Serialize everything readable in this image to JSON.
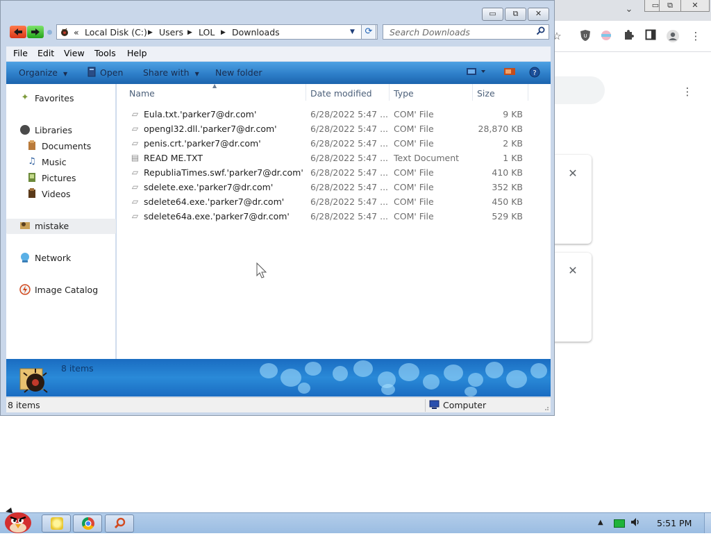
{
  "explorer": {
    "window_controls": {
      "minimize": "▭",
      "maximize": "⧉",
      "close": "✕"
    },
    "breadcrumb": [
      "Local Disk (C:)",
      "Users",
      "LOL",
      "Downloads"
    ],
    "search_placeholder": "Search Downloads",
    "menu": [
      "File",
      "Edit",
      "View",
      "Tools",
      "Help"
    ],
    "commands": {
      "organize": "Organize",
      "open": "Open",
      "share_with": "Share with",
      "new_folder": "New folder"
    },
    "nav": {
      "favorites": "Favorites",
      "libraries": "Libraries",
      "library_items": [
        "Documents",
        "Music",
        "Pictures",
        "Videos"
      ],
      "user": "mistake",
      "network": "Network",
      "image_catalog": "Image Catalog"
    },
    "columns": {
      "name": "Name",
      "date": "Date modified",
      "type": "Type",
      "size": "Size"
    },
    "files": [
      {
        "name": "Eula.txt.'parker7@dr.com'",
        "date": "6/28/2022 5:47 ...",
        "type": "COM' File",
        "size": "9 KB"
      },
      {
        "name": "opengl32.dll.'parker7@dr.com'",
        "date": "6/28/2022 5:47 ...",
        "type": "COM' File",
        "size": "28,870 KB"
      },
      {
        "name": "penis.crt.'parker7@dr.com'",
        "date": "6/28/2022 5:47 ...",
        "type": "COM' File",
        "size": "2 KB"
      },
      {
        "name": "READ ME.TXT",
        "date": "6/28/2022 5:47 ...",
        "type": "Text Document",
        "size": "1 KB"
      },
      {
        "name": "RepubliaTimes.swf.'parker7@dr.com'",
        "date": "6/28/2022 5:47 ...",
        "type": "COM' File",
        "size": "410 KB"
      },
      {
        "name": "sdelete.exe.'parker7@dr.com'",
        "date": "6/28/2022 5:47 ...",
        "type": "COM' File",
        "size": "352 KB"
      },
      {
        "name": "sdelete64.exe.'parker7@dr.com'",
        "date": "6/28/2022 5:47 ...",
        "type": "COM' File",
        "size": "450 KB"
      },
      {
        "name": "sdelete64a.exe.'parker7@dr.com'",
        "date": "6/28/2022 5:47 ...",
        "type": "COM' File",
        "size": "529 KB"
      }
    ],
    "details_count": "8 items",
    "status_count": "8 items",
    "status_location": "Computer"
  },
  "chrome": {
    "window_controls": {
      "chevron": "⌄",
      "minimize": "▭",
      "restore": "⧉",
      "close": "✕"
    },
    "extension_icons": [
      "star-icon",
      "ublock-icon",
      "translate-icon",
      "puzzle-icon",
      "sidepanel-icon",
      "profile-icon",
      "kebab-menu-icon"
    ],
    "card_close": "✕"
  },
  "taskbar": {
    "clock": "5:51 PM"
  },
  "colors": {
    "command_bar": "#2e7fc9",
    "details_pane": "#1a6cc1",
    "taskbar": "#9bbde2",
    "tray_battery": "#1fb33a"
  }
}
